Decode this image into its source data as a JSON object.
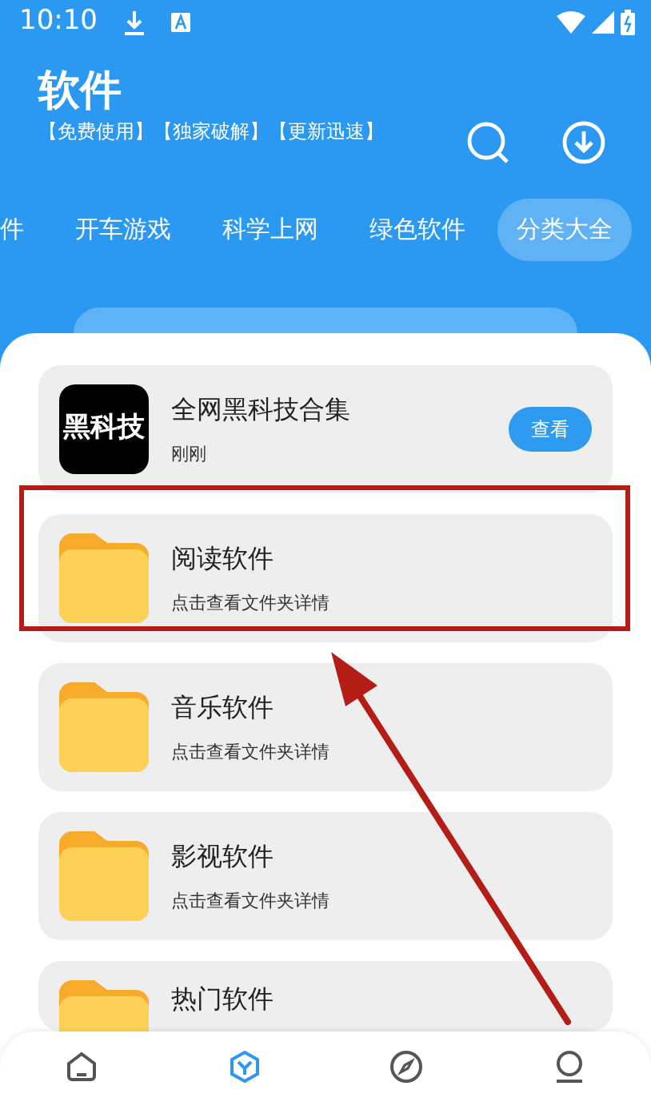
{
  "status_bar": {
    "time": "10:10"
  },
  "header": {
    "title": "软件",
    "tagline": "【免费使用】【独家破解】【更新迅速】"
  },
  "tabs": [
    {
      "label": "件",
      "selected": false
    },
    {
      "label": "开车游戏",
      "selected": false
    },
    {
      "label": "科学上网",
      "selected": false
    },
    {
      "label": "绿色软件",
      "selected": false
    },
    {
      "label": "分类大全",
      "selected": true
    }
  ],
  "items": [
    {
      "kind": "app",
      "title": "全网黑科技合集",
      "subtitle": "刚刚",
      "thumb_text": "黑科技",
      "button": "查看",
      "highlighted": false
    },
    {
      "kind": "folder",
      "title": "阅读软件",
      "subtitle": "点击查看文件夹详情",
      "highlighted": true
    },
    {
      "kind": "folder",
      "title": "音乐软件",
      "subtitle": "点击查看文件夹详情",
      "highlighted": false
    },
    {
      "kind": "folder",
      "title": "影视软件",
      "subtitle": "点击查看文件夹详情",
      "highlighted": false
    },
    {
      "kind": "folder",
      "title": "热门软件",
      "highlighted": false
    }
  ],
  "bottom_nav": [
    {
      "selected": false
    },
    {
      "selected": true
    },
    {
      "selected": false
    },
    {
      "selected": false
    }
  ]
}
